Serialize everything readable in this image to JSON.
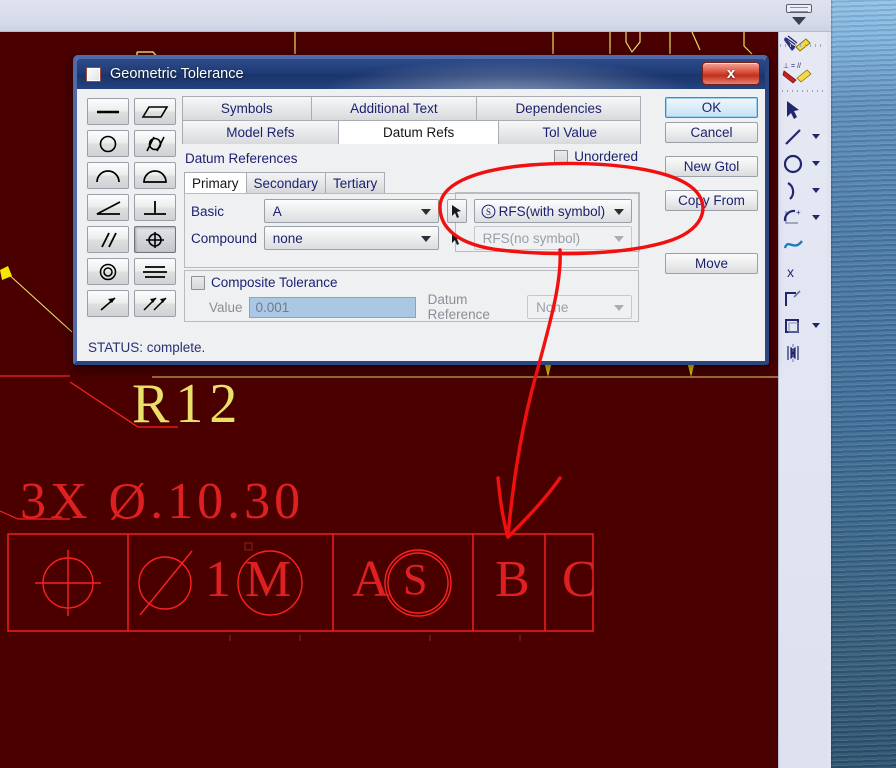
{
  "window": {
    "title": "Geometric Tolerance",
    "title_icon": "window-box-icon",
    "close_label": "x",
    "status": "STATUS: complete."
  },
  "symbol_palette": {
    "name": "gdt-symbol-palette",
    "rows": [
      [
        {
          "id": "straightness",
          "selected": false
        },
        {
          "id": "flatness",
          "selected": false
        }
      ],
      [
        {
          "id": "circularity",
          "selected": false
        },
        {
          "id": "cylindricity",
          "selected": false
        }
      ],
      [
        {
          "id": "line-profile",
          "selected": false
        },
        {
          "id": "surface-profile",
          "selected": false
        }
      ],
      [
        {
          "id": "angularity",
          "selected": false
        },
        {
          "id": "perpendicularity",
          "selected": false
        }
      ],
      [
        {
          "id": "parallelism",
          "selected": false
        },
        {
          "id": "position",
          "selected": true
        }
      ],
      [
        {
          "id": "concentricity",
          "selected": false
        },
        {
          "id": "symmetry",
          "selected": false
        }
      ],
      [
        {
          "id": "circular-runout",
          "selected": false
        },
        {
          "id": "total-runout",
          "selected": false
        }
      ]
    ]
  },
  "tabs": {
    "row1": [
      {
        "label": "Symbols",
        "active": false
      },
      {
        "label": "Additional Text",
        "active": false
      },
      {
        "label": "Dependencies",
        "active": false
      }
    ],
    "row2": [
      {
        "label": "Model Refs",
        "active": false
      },
      {
        "label": "Datum Refs",
        "active": true
      },
      {
        "label": "Tol Value",
        "active": false
      }
    ]
  },
  "panel": {
    "section_title": "Datum References",
    "unordered": {
      "label": "Unordered",
      "checked": false
    },
    "subtabs": [
      {
        "label": "Primary",
        "active": true
      },
      {
        "label": "Secondary",
        "active": false
      },
      {
        "label": "Tertiary",
        "active": false
      }
    ],
    "basic": {
      "label": "Basic",
      "value": "A",
      "modifier": "RFS(with symbol)",
      "modifier_symbol": "S",
      "picker_icon": "cursor-arrow-icon"
    },
    "compound": {
      "label": "Compound",
      "value": "none",
      "modifier": "RFS(no symbol)",
      "picker_icon": "cursor-arrow-icon"
    },
    "composite": {
      "label": "Composite Tolerance",
      "checked": false,
      "value_label": "Value",
      "value": "0.001",
      "datum_ref_label": "Datum Reference",
      "datum_ref_value": "None"
    }
  },
  "buttons": [
    {
      "label": "OK",
      "primary": true,
      "name": "ok-button"
    },
    {
      "label": "Cancel",
      "primary": false,
      "name": "cancel-button"
    },
    {
      "label": "New Gtol",
      "primary": false,
      "name": "new-gtol-button"
    },
    {
      "label": "Copy From",
      "primary": false,
      "name": "copy-from-button"
    },
    {
      "label": "Move",
      "primary": false,
      "name": "move-button"
    }
  ],
  "right_toolbar": {
    "items": [
      {
        "id": "sketch-datum-icon",
        "caret": false
      },
      {
        "id": "geometric-tolerance-icon",
        "caret": false
      },
      {
        "id": "separator",
        "caret": false
      },
      {
        "id": "select-arrow-icon",
        "caret": false
      },
      {
        "id": "line-icon",
        "caret": true
      },
      {
        "id": "circle-icon",
        "caret": true
      },
      {
        "id": "arc-icon",
        "caret": true
      },
      {
        "id": "fillet-icon",
        "caret": true
      },
      {
        "id": "spline-icon",
        "caret": false
      },
      {
        "id": "point-icon",
        "caret": false
      },
      {
        "id": "trim-icon",
        "caret": false
      },
      {
        "id": "rectangle-icon",
        "caret": true
      },
      {
        "id": "mirror-icon",
        "caret": false
      }
    ]
  },
  "canvas": {
    "background_color": "#4b0000",
    "annotation_color": "#ff1010",
    "dimension_color": "#e8e06a",
    "drawing_color": "#ff2020",
    "labels": {
      "radius": "R12",
      "hole_callout": "3X  Ø.10.30"
    },
    "feature_control_frame": {
      "cells": [
        {
          "text": "position-symbol",
          "type": "symbol"
        },
        {
          "text": "Ø 1 M",
          "type": "tolerance"
        },
        {
          "text": "A S",
          "type": "datum-modifier"
        },
        {
          "text": "B",
          "type": "datum"
        },
        {
          "text": "C",
          "type": "datum"
        }
      ]
    }
  },
  "scroll_widget": {
    "name": "canvas-scroll-widget"
  }
}
